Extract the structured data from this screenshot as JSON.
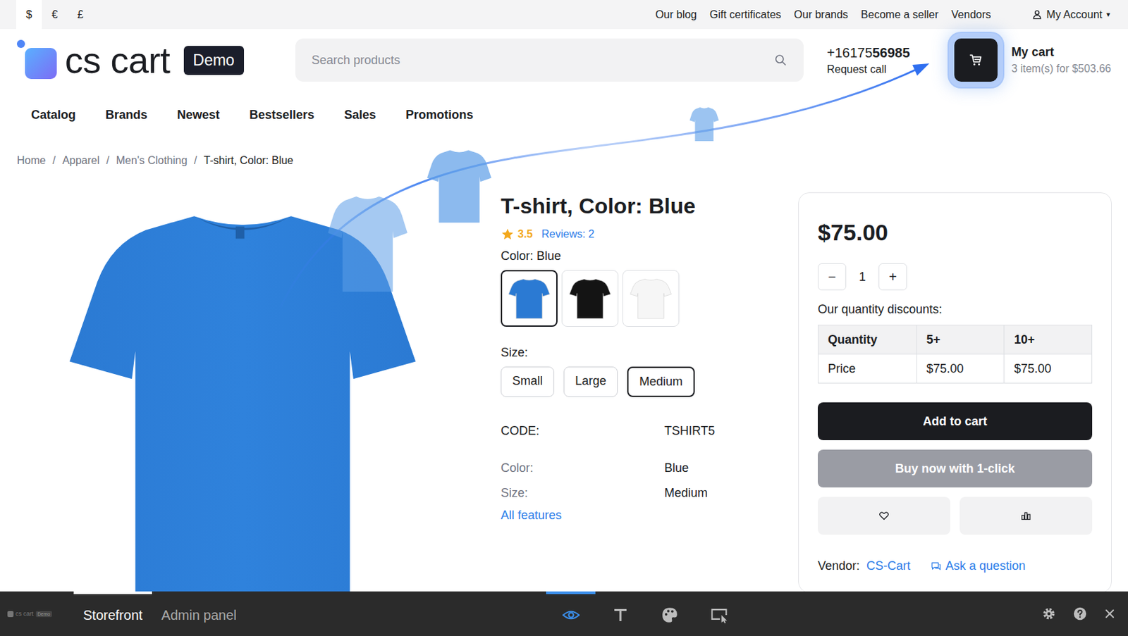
{
  "currencies": [
    {
      "symbol": "$",
      "selected": true
    },
    {
      "symbol": "€",
      "selected": false
    },
    {
      "symbol": "£",
      "selected": false
    }
  ],
  "top_links": [
    "Our blog",
    "Gift certificates",
    "Our brands",
    "Become a seller",
    "Vendors"
  ],
  "account": {
    "label": "My Account",
    "caret": "▾"
  },
  "logo": {
    "name": "cs cart",
    "badge": "Demo"
  },
  "search": {
    "placeholder": "Search products"
  },
  "phone": {
    "prefix": "+16175",
    "bold": "56985",
    "action": "Request call"
  },
  "cart": {
    "title": "My cart",
    "summary": "3 item(s) for $503.66",
    "highlighted": true
  },
  "nav": [
    "Catalog",
    "Brands",
    "Newest",
    "Bestsellers",
    "Sales",
    "Promotions"
  ],
  "breadcrumbs": {
    "separator": "/",
    "items": [
      {
        "label": "Home",
        "current": false
      },
      {
        "label": "Apparel",
        "current": false
      },
      {
        "label": "Men's Clothing",
        "current": false
      },
      {
        "label": "T-shirt, Color: Blue",
        "current": true
      }
    ]
  },
  "product": {
    "title": "T-shirt, Color: Blue",
    "stars": 1,
    "rating": "3.5",
    "reviews": "Reviews: 2",
    "color_label": "Color:",
    "color_value": "Blue",
    "swatches": [
      {
        "selected": true,
        "color": "#2b7ad3"
      },
      {
        "selected": false,
        "color": "#141414"
      },
      {
        "selected": false,
        "color": "#f6f6f6"
      }
    ],
    "size_label": "Size:",
    "sizes": [
      {
        "label": "Small",
        "selected": false
      },
      {
        "label": "Large",
        "selected": false
      },
      {
        "label": "Medium",
        "selected": true
      }
    ],
    "code": {
      "label": "CODE:",
      "value": "TSHIRT5"
    },
    "features": [
      {
        "label": "Color:",
        "value": "Blue"
      },
      {
        "label": "Size:",
        "value": "Medium"
      }
    ],
    "all_features": "All features"
  },
  "buy_box": {
    "price": "$75.00",
    "minus": "−",
    "quantity": "1",
    "plus": "+",
    "discounts_title": "Our quantity discounts:",
    "discount_table": {
      "columns": [
        "Quantity",
        "5+",
        "10+"
      ],
      "rows": [
        [
          "Price",
          "$75.00",
          "$75.00"
        ]
      ]
    },
    "add_to_cart": "Add to cart",
    "buy_now": {
      "label": "Buy now with 1-click",
      "disabled": true
    },
    "vendor_label": "Vendor:",
    "vendor": "CS-Cart",
    "ask": "Ask a question"
  },
  "toolbar": {
    "logo": {
      "name": "cs cart",
      "badge": "Demo"
    },
    "tabs": [
      {
        "label": "Storefront",
        "selected": true
      },
      {
        "label": "Admin panel",
        "selected": false
      }
    ],
    "tools": [
      {
        "kind": "preview",
        "selected": true
      },
      {
        "kind": "text",
        "selected": false
      },
      {
        "kind": "theme",
        "selected": false
      },
      {
        "kind": "layout",
        "selected": false
      }
    ]
  }
}
